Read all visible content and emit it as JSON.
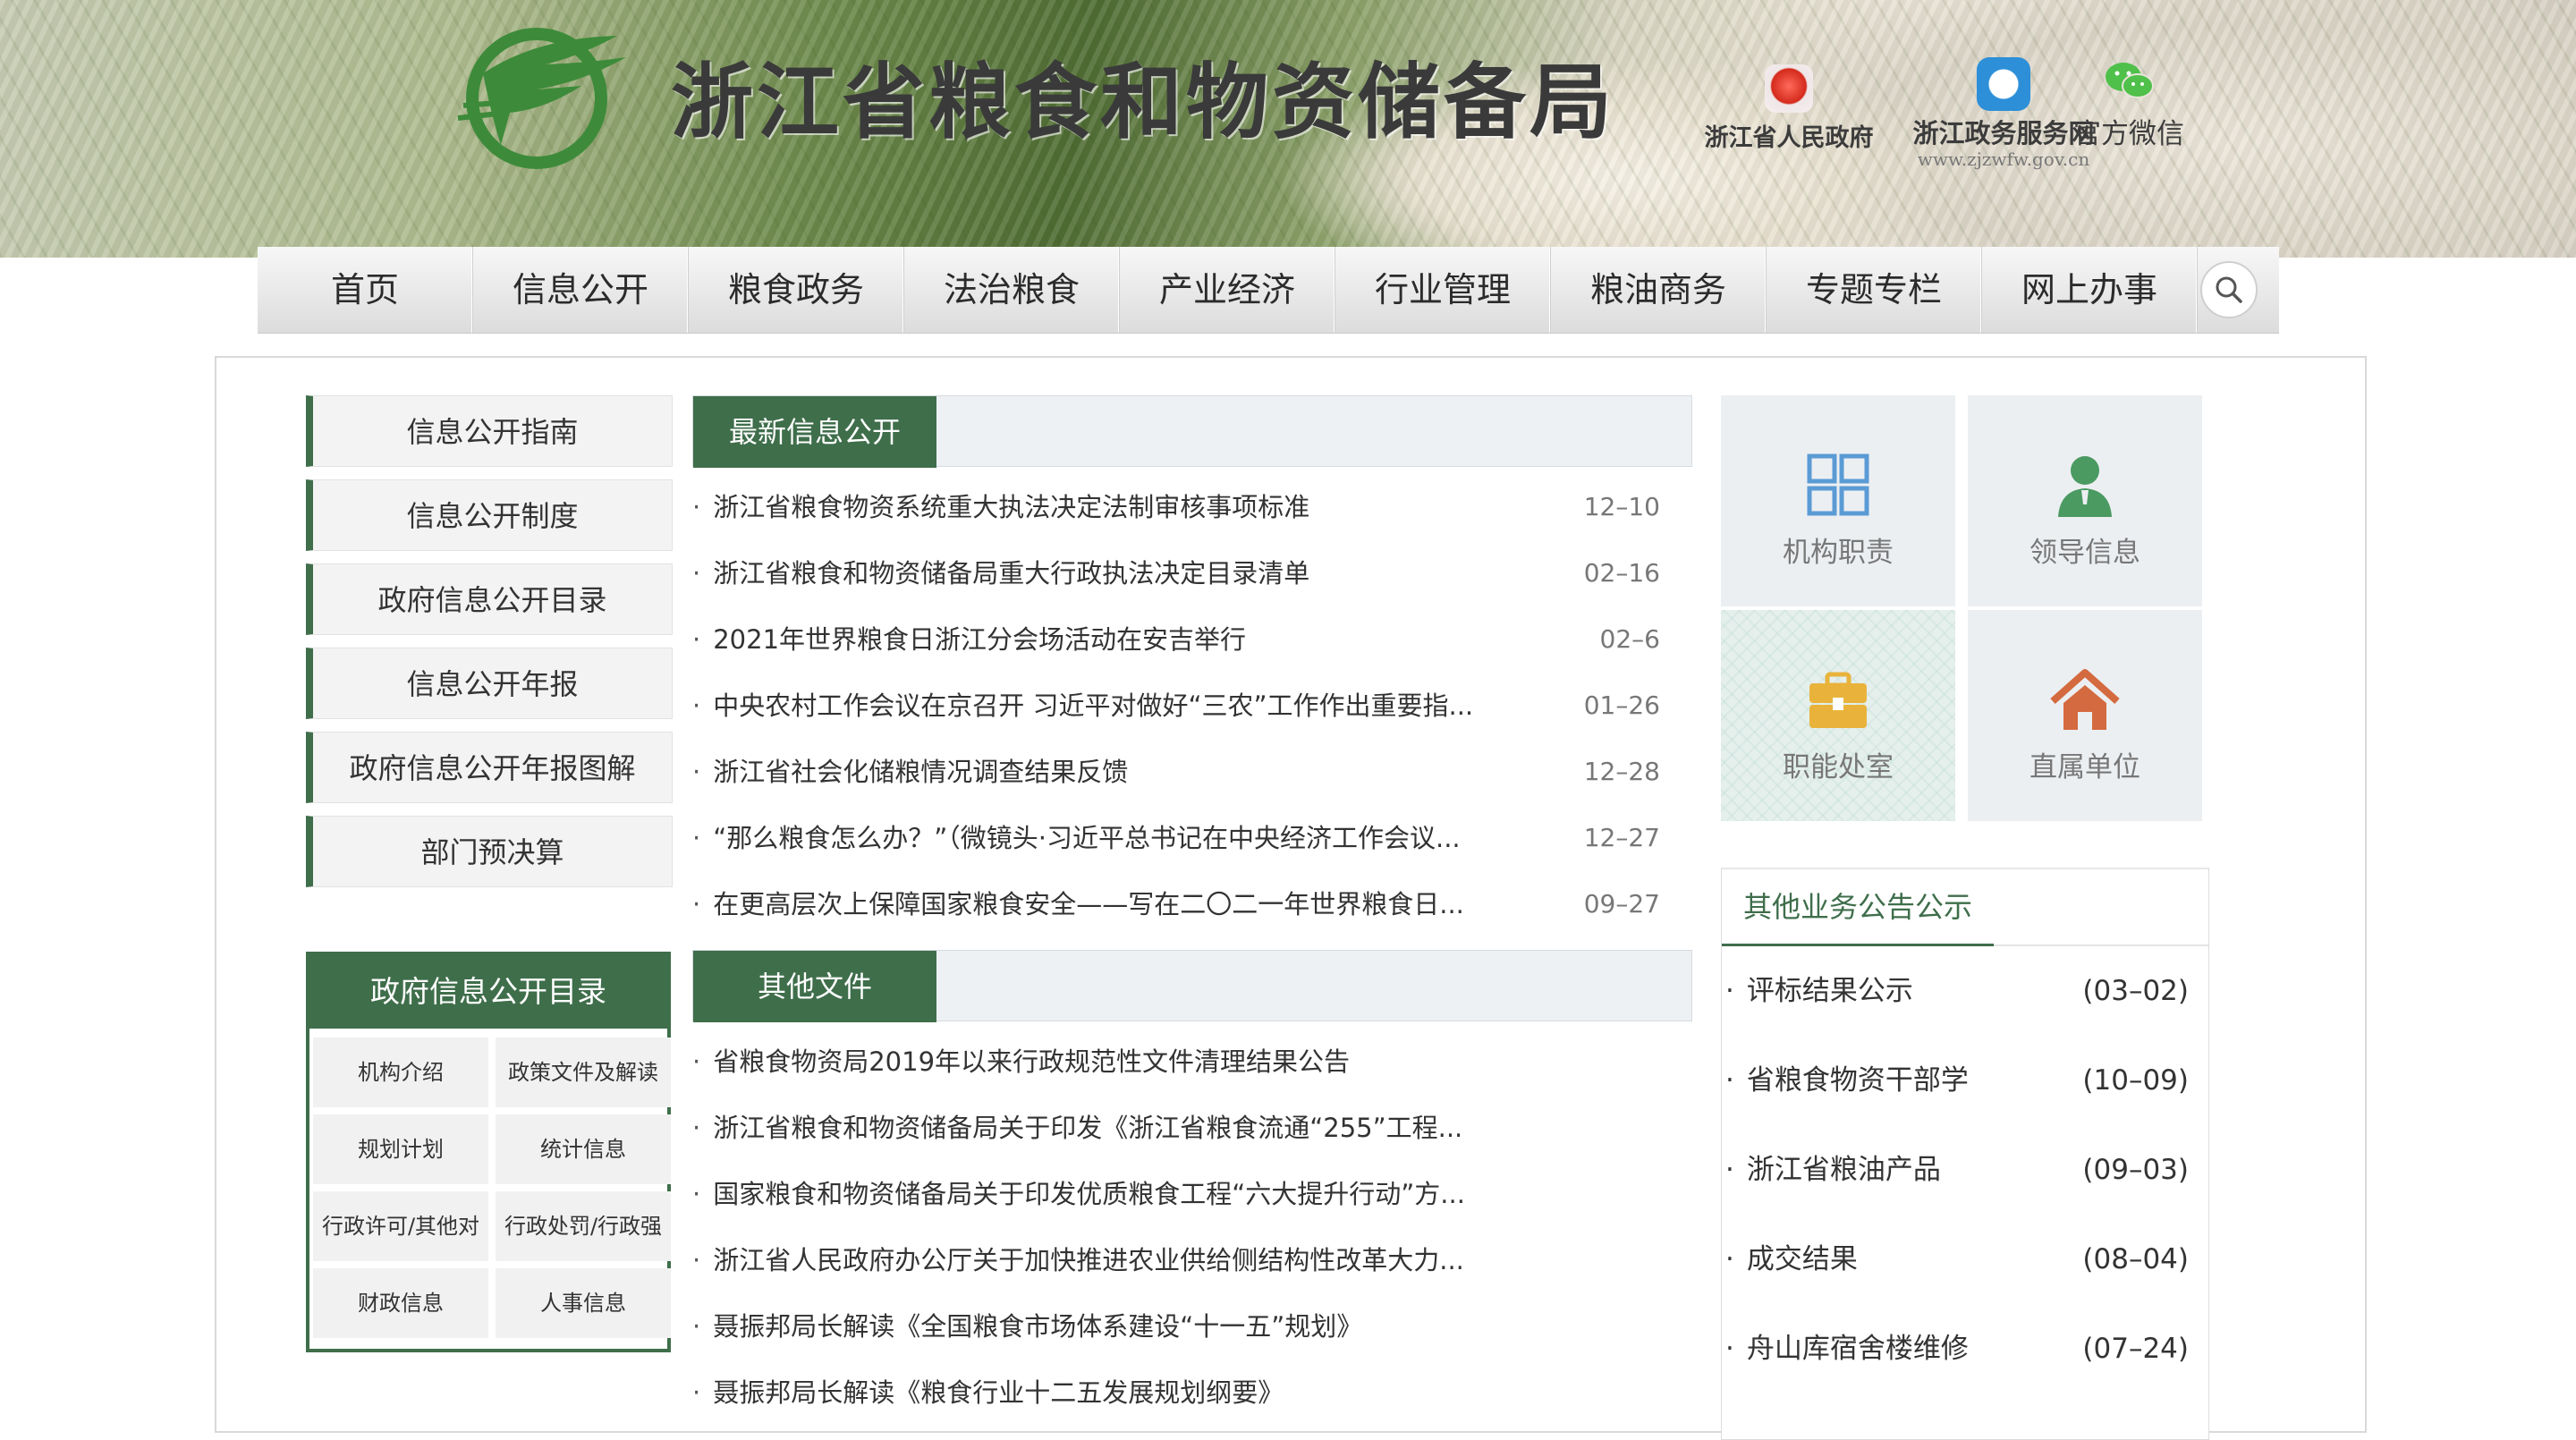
{
  "header": {
    "site_title": "浙江省粮食和物资储备局",
    "links": {
      "gov_portal": "浙江省人民政府",
      "service_net": "浙江政务服务网",
      "service_net_url": "www.zjzwfw.gov.cn",
      "wechat": "官方微信"
    }
  },
  "nav": {
    "items": [
      "首页",
      "信息公开",
      "粮食政务",
      "法治粮食",
      "产业经济",
      "行业管理",
      "粮油商务",
      "专题专栏",
      "网上办事"
    ],
    "search_icon": "search-icon"
  },
  "sidebar": {
    "links": [
      "信息公开指南",
      "信息公开制度",
      "政府信息公开目录",
      "信息公开年报",
      "政府信息公开年报图解",
      "部门预决算"
    ],
    "directory": {
      "title": "政府信息公开目录",
      "cells": [
        "机构介绍",
        "政策文件及解读",
        "规划计划",
        "统计信息",
        "行政许可/其他对",
        "行政处罚/行政强",
        "财政信息",
        "人事信息"
      ]
    }
  },
  "latest": {
    "tab": "最新信息公开",
    "items": [
      {
        "title": "浙江省粮食物资系统重大执法决定法制审核事项标准",
        "date": "12–10"
      },
      {
        "title": "浙江省粮食和物资储备局重大行政执法决定目录清单",
        "date": "02–16"
      },
      {
        "title": "2021年世界粮食日浙江分会场活动在安吉举行",
        "date": "02–6"
      },
      {
        "title": "中央农村工作会议在京召开 习近平对做好“三农”工作作出重要指...",
        "date": "01–26"
      },
      {
        "title": "浙江省社会化储粮情况调查结果反馈",
        "date": "12–28"
      },
      {
        "title": "“那么粮食怎么办？”（微镜头·习近平总书记在中央经济工作会议...",
        "date": "12–27"
      },
      {
        "title": "在更高层次上保障国家粮食安全——写在二〇二一年世界粮食日...",
        "date": "09–27"
      }
    ]
  },
  "other_docs": {
    "tab": "其他文件",
    "items": [
      "省粮食物资局2019年以来行政规范性文件清理结果公告",
      "浙江省粮食和物资储备局关于印发《浙江省粮食流通“255”工程...",
      "国家粮食和物资储备局关于印发优质粮食工程“六大提升行动”方...",
      "浙江省人民政府办公厅关于加快推进农业供给侧结构性改革大力...",
      "聂振邦局长解读《全国粮食市场体系建设“十一五”规划》",
      "聂振邦局长解读《粮食行业十二五发展规划纲要》"
    ]
  },
  "tiles": [
    {
      "label": "机构职责",
      "icon": "grid-icon",
      "color": "#5b9bd5"
    },
    {
      "label": "领导信息",
      "icon": "person-icon",
      "color": "#4a9a62"
    },
    {
      "label": "职能处室",
      "icon": "briefcase-icon",
      "color": "#e9b33b"
    },
    {
      "label": "直属单位",
      "icon": "home-icon",
      "color": "#d46a3f"
    }
  ],
  "notices": {
    "title": "其他业务公告公示",
    "items": [
      {
        "title": "评标结果公示",
        "date": "(03–02)"
      },
      {
        "title": "省粮食物资干部学",
        "date": "(10–09)"
      },
      {
        "title": "浙江省粮油产品",
        "date": "(09–03)"
      },
      {
        "title": "成交结果",
        "date": "(08–04)"
      },
      {
        "title": "舟山库宿舍楼维修",
        "date": "(07–24)"
      }
    ]
  },
  "colors": {
    "brand_green": "#3f6e4b",
    "logo_green": "#3d8b3a"
  }
}
